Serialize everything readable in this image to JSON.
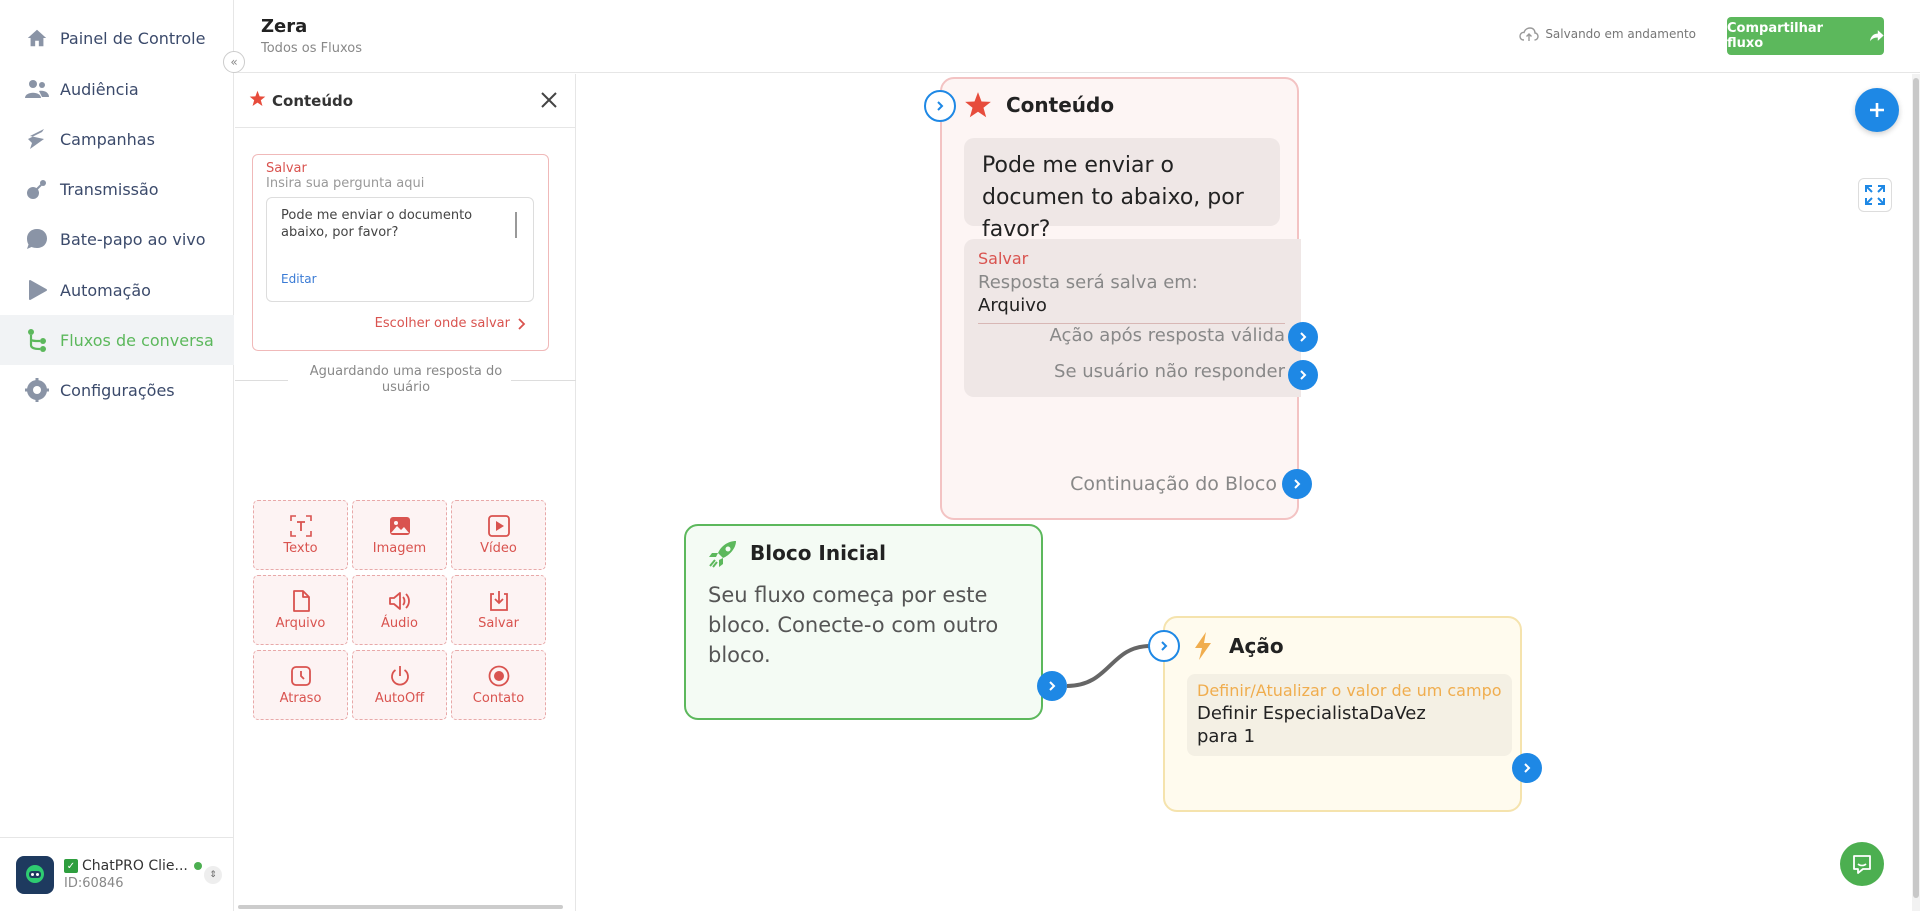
{
  "sidebar": {
    "items": [
      {
        "label": "Painel de Controle",
        "icon": "home-icon"
      },
      {
        "label": "Audiência",
        "icon": "users-icon"
      },
      {
        "label": "Campanhas",
        "icon": "campaign-icon"
      },
      {
        "label": "Transmissão",
        "icon": "broadcast-icon"
      },
      {
        "label": "Bate-papo ao vivo",
        "icon": "chat-bubble-icon"
      },
      {
        "label": "Automação",
        "icon": "play-icon"
      },
      {
        "label": "Fluxos de conversa",
        "icon": "flow-icon"
      },
      {
        "label": "Configurações",
        "icon": "gear-icon"
      }
    ],
    "active": "Fluxos de conversa",
    "account": {
      "name": "ChatPRO Clie...",
      "id": "ID:60846"
    }
  },
  "header": {
    "title": "Zera",
    "subtitle": "Todos os Fluxos",
    "saving_status": "Salvando em andamento",
    "share_label": "Compartilhar fluxo"
  },
  "panel": {
    "title": "Conteúdo",
    "save_label": "Salvar",
    "question_placeholder": "Insira sua pergunta aqui",
    "question_text": "Pode me enviar o documento abaixo, por favor?",
    "edit_label": "Editar",
    "choose_save_label": "Escolher onde salvar",
    "awaiting_text": "Aguardando uma resposta do usuário",
    "tiles": [
      {
        "label": "Texto",
        "icon": "text-icon"
      },
      {
        "label": "Imagem",
        "icon": "image-icon"
      },
      {
        "label": "Vídeo",
        "icon": "video-icon"
      },
      {
        "label": "Arquivo",
        "icon": "file-icon"
      },
      {
        "label": "Áudio",
        "icon": "audio-icon"
      },
      {
        "label": "Salvar",
        "icon": "download-icon"
      },
      {
        "label": "Atraso",
        "icon": "clock-icon"
      },
      {
        "label": "AutoOff",
        "icon": "power-icon"
      },
      {
        "label": "Contato",
        "icon": "contact-icon"
      }
    ]
  },
  "canvas": {
    "content_node": {
      "title": "Conteúdo",
      "message": "Pode me enviar o documen to abaixo, por favor?",
      "save_label": "Salvar",
      "save_info": "Resposta será salva em:",
      "save_target": "Arquivo",
      "valid_action": "Ação após resposta válida",
      "no_response": "Se usuário não responder",
      "continuation": "Continuação do Bloco"
    },
    "start_node": {
      "title": "Bloco Inicial",
      "text": "Seu fluxo começa por este bloco. Conecte-o com outro bloco."
    },
    "action_node": {
      "title": "Ação",
      "label": "Definir/Atualizar o valor de um campo",
      "text": "Definir EspecialistaDaVez para 1"
    }
  },
  "colors": {
    "accent_green": "#5cb85c",
    "accent_blue": "#1e88e5",
    "accent_red": "#d9534f",
    "accent_orange": "#f0ad4e"
  }
}
